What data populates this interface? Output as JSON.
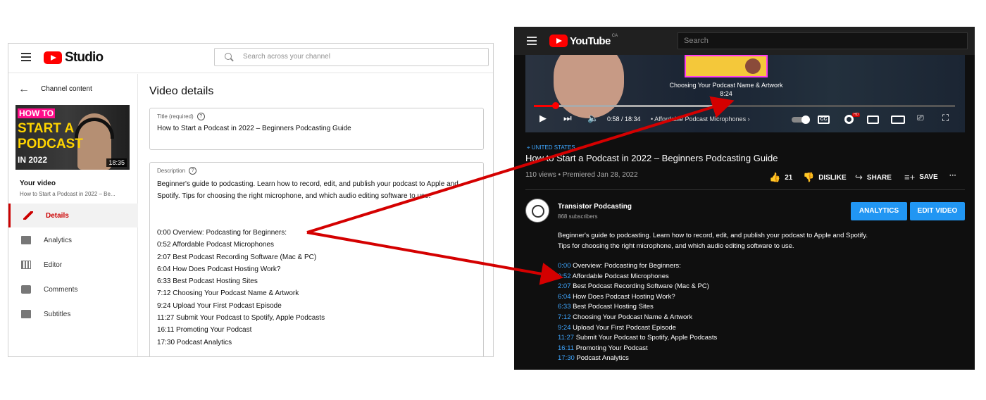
{
  "studio": {
    "brand": "Studio",
    "search_placeholder": "Search across your channel",
    "back_label": "Channel content",
    "thumbnail": {
      "line1": "HOW TO",
      "line2": "START A",
      "line3": "PODCAST",
      "line4": "IN 2022",
      "duration": "18:35"
    },
    "your_video_label": "Your video",
    "your_video_title": "How to Start a Podcast in 2022 – Be...",
    "nav": [
      {
        "label": "Details",
        "icon": "pencil-icon",
        "active": true
      },
      {
        "label": "Analytics",
        "icon": "analytics-icon",
        "active": false
      },
      {
        "label": "Editor",
        "icon": "editor-icon",
        "active": false
      },
      {
        "label": "Comments",
        "icon": "comments-icon",
        "active": false
      },
      {
        "label": "Subtitles",
        "icon": "subtitles-icon",
        "active": false
      }
    ],
    "page_title": "Video details",
    "title_label": "Title (required)",
    "title_value": "How to Start a Podcast in 2022 – Beginners Podcasting Guide",
    "description_label": "Description",
    "description_intro": "Beginner's guide to podcasting. Learn how to record, edit, and publish your podcast to Apple and Spotify. Tips for choosing the right microphone, and which audio editing software to use.",
    "chapters": [
      "0:00 Overview: Podcasting for Beginners:",
      "0:52 Affordable Podcast Microphones",
      "2:07 Best Podcast Recording Software (Mac & PC)",
      "6:04 How Does Podcast Hosting Work?",
      "6:33 Best Podcast Hosting Sites",
      "7:12 Choosing Your Podcast Name & Artwork",
      "9:24 Upload Your First Podcast Episode",
      "11:27 Submit Your Podcast to Spotify, Apple Podcasts",
      "16:11 Promoting Your Podcast",
      "17:30 Podcast Analytics"
    ]
  },
  "youtube": {
    "brand": "YouTube",
    "country": "CA",
    "search_placeholder": "Search",
    "player": {
      "hover_chapter": "Choosing Your Podcast Name & Artwork",
      "hover_time": "8:24",
      "time": "0:58 / 18:34",
      "current_chapter": "Affordable Podcast Microphones",
      "chevron": "›",
      "cc_label": "CC",
      "hd_label": "HD",
      "progress_fraction": 0.052,
      "hover_fraction": 0.452
    },
    "location": "UNITED STATES",
    "title": "How to Start a Podcast in 2022 – Beginners Podcasting Guide",
    "stats": "110 views • Premiered Jan 28, 2022",
    "likes": "21",
    "dislike_label": "DISLIKE",
    "share_label": "SHARE",
    "save_label": "SAVE",
    "more_label": "···",
    "channel_name": "Transistor Podcasting",
    "channel_subs": "868 subscribers",
    "analytics_button": "ANALYTICS",
    "edit_button": "EDIT VIDEO",
    "description": "Beginner's guide to podcasting. Learn how to record, edit, and publish your podcast to Apple and Spotify. Tips for choosing the right microphone, and which audio editing software to use.",
    "chapters": [
      {
        "time": "0:00",
        "label": "Overview: Podcasting for Beginners:"
      },
      {
        "time": "0:52",
        "label": "Affordable Podcast Microphones"
      },
      {
        "time": "2:07",
        "label": "Best Podcast Recording Software (Mac & PC)"
      },
      {
        "time": "6:04",
        "label": "How Does Podcast Hosting Work?"
      },
      {
        "time": "6:33",
        "label": "Best Podcast Hosting Sites"
      },
      {
        "time": "7:12",
        "label": "Choosing Your Podcast Name & Artwork"
      },
      {
        "time": "9:24",
        "label": "Upload Your First Podcast Episode"
      },
      {
        "time": "11:27",
        "label": "Submit Your Podcast to Spotify, Apple Podcasts"
      },
      {
        "time": "16:11",
        "label": "Promoting Your Podcast"
      },
      {
        "time": "17:30",
        "label": "Podcast Analytics"
      }
    ]
  },
  "colors": {
    "arrow": "#d40000",
    "link_blue": "#3ea6ff",
    "button_blue": "#2196f3",
    "studio_accent": "#cc0000"
  }
}
